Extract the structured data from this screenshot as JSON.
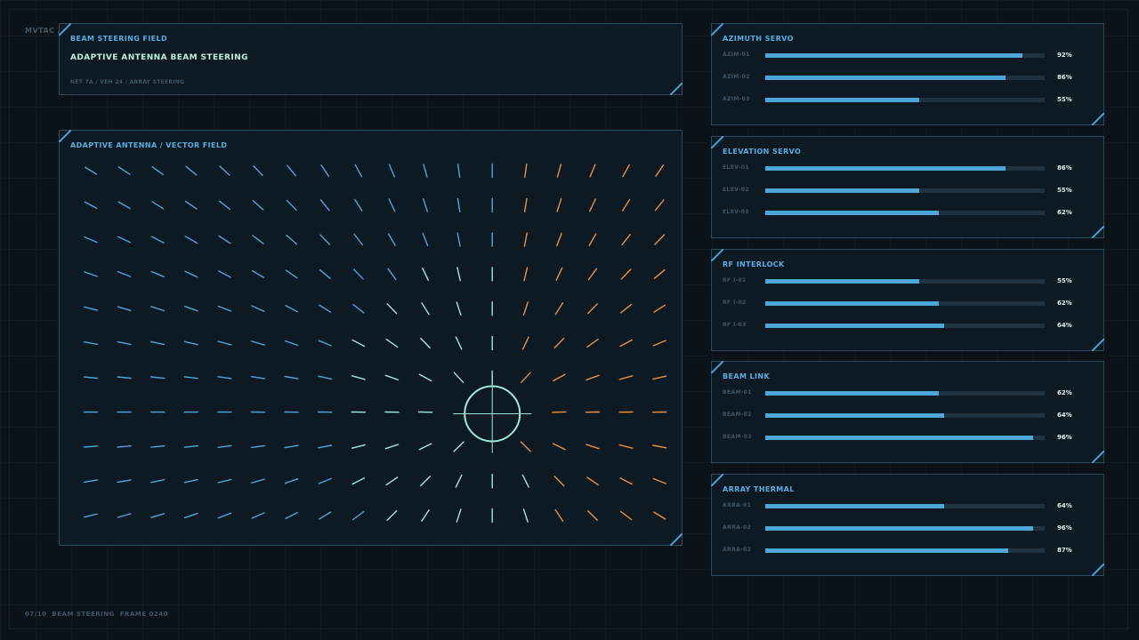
{
  "breadcrumb": "MVTAC /",
  "header": {
    "section": "BEAM STEERING FIELD",
    "title": "ADAPTIVE ANTENNA BEAM STEERING",
    "path": "NET 7A / VEH 24 / ARRAY STEERING"
  },
  "field": {
    "title": "ADAPTIVE ANTENNA / VECTOR FIELD",
    "cols": 18,
    "rows": 11,
    "focus": {
      "col": 12,
      "row": 7.05
    },
    "colors": {
      "cool": "#4fa6d9",
      "near": "#9fe8dc",
      "warm": "#e8924a"
    }
  },
  "footer": "07/10  BEAM STEERING  FRAME 0240",
  "colors": {
    "accent": "#4fa6d9",
    "value": "#dff4ee",
    "label": "#3f5666"
  },
  "groups": [
    {
      "title": "AZIMUTH SERVO",
      "items": [
        {
          "label": "AZIM-01",
          "value": "92%",
          "level": 0.92
        },
        {
          "label": "AZIM-02",
          "value": "86%",
          "level": 0.86
        },
        {
          "label": "AZIM-03",
          "value": "55%",
          "level": 0.55
        }
      ]
    },
    {
      "title": "ELEVATION SERVO",
      "items": [
        {
          "label": "ELEV-01",
          "value": "86%",
          "level": 0.86
        },
        {
          "label": "ELEV-02",
          "value": "55%",
          "level": 0.55
        },
        {
          "label": "ELEV-03",
          "value": "62%",
          "level": 0.62
        }
      ]
    },
    {
      "title": "RF INTERLOCK",
      "items": [
        {
          "label": "RF I-01",
          "value": "55%",
          "level": 0.55
        },
        {
          "label": "RF I-02",
          "value": "62%",
          "level": 0.62
        },
        {
          "label": "RF I-03",
          "value": "64%",
          "level": 0.64
        }
      ]
    },
    {
      "title": "BEAM LINK",
      "items": [
        {
          "label": "BEAM-01",
          "value": "62%",
          "level": 0.62
        },
        {
          "label": "BEAM-02",
          "value": "64%",
          "level": 0.64
        },
        {
          "label": "BEAM-03",
          "value": "96%",
          "level": 0.96
        }
      ]
    },
    {
      "title": "ARRAY THERMAL",
      "items": [
        {
          "label": "ARRA-01",
          "value": "64%",
          "level": 0.64
        },
        {
          "label": "ARRA-02",
          "value": "96%",
          "level": 0.96
        },
        {
          "label": "ARRA-03",
          "value": "87%",
          "level": 0.87
        }
      ]
    }
  ]
}
